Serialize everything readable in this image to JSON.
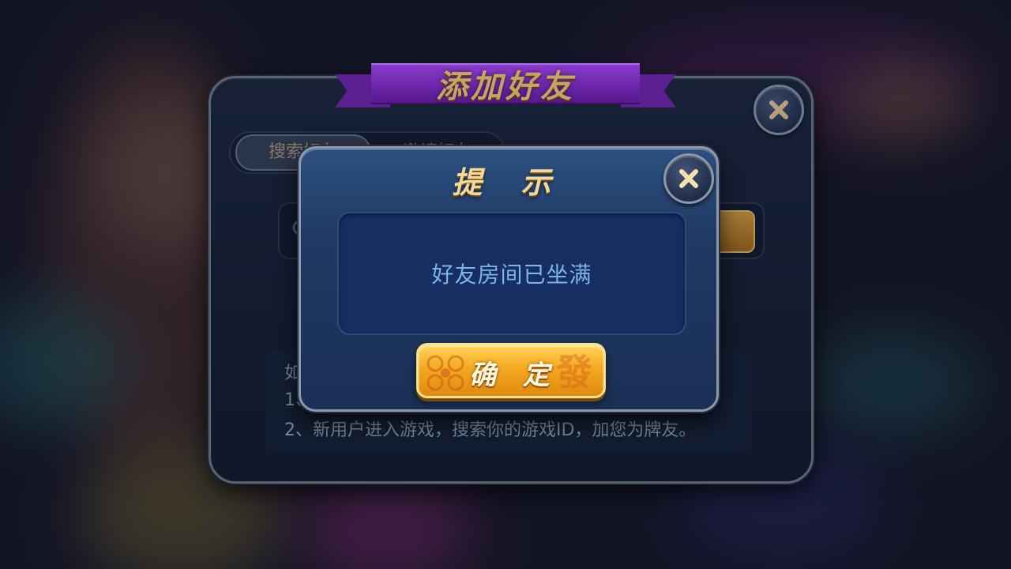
{
  "background": {
    "description_colors": [
      "#3c1a4a",
      "#c43a9a",
      "#2c8a8a",
      "#d9a050",
      "#6a4a30"
    ]
  },
  "add_friend_panel": {
    "title": "添加好友",
    "tabs": [
      {
        "label": "搜索好友",
        "active": true
      },
      {
        "label": "邀请好友",
        "active": false
      }
    ],
    "info_lines": [
      "如",
      "1、",
      "2、新用户进入游戏，搜索你的游戏ID，加您为牌友。"
    ],
    "close_icon": "close-icon"
  },
  "hint_dialog": {
    "title": "提 示",
    "message": "好友房间已坐满",
    "confirm_label": "确定",
    "confirm_deco_char": "發",
    "close_icon": "close-icon"
  },
  "colors": {
    "ribbon_purple": "#6a24a8",
    "title_gold": "#f2d89a",
    "message_blue": "#7db4e8",
    "button_orange": "#f5a920"
  }
}
